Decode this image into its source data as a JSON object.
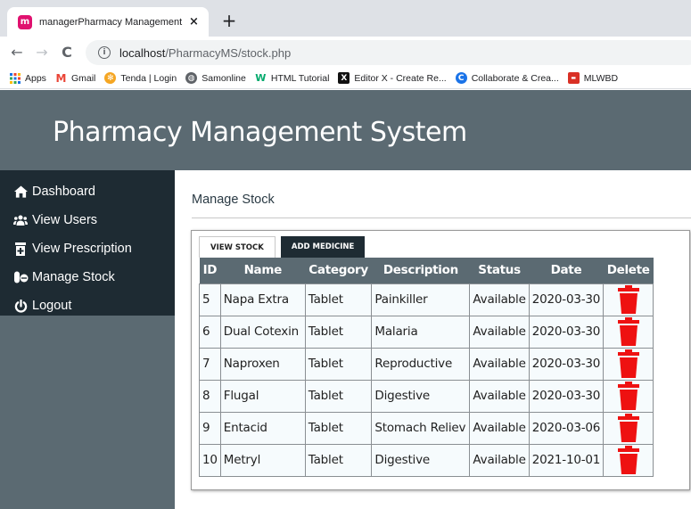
{
  "browser": {
    "tab_title": "managerPharmacy Management",
    "tab_close": "×",
    "new_tab": "+",
    "url_host": "localhost",
    "url_path": "/PharmacyMS/stock.php",
    "nav": {
      "back": "←",
      "forward": "→",
      "reload": "C"
    },
    "bookmarks": [
      {
        "label": "Apps",
        "icon": "apps-icon"
      },
      {
        "label": "Gmail",
        "icon": "gmail-icon"
      },
      {
        "label": "Tenda | Login",
        "icon": "tenda-icon"
      },
      {
        "label": "Samonline",
        "icon": "globe-icon"
      },
      {
        "label": "HTML Tutorial",
        "icon": "w3-icon"
      },
      {
        "label": "Editor X - Create Re...",
        "icon": "editorx-icon"
      },
      {
        "label": "Collaborate & Crea...",
        "icon": "collab-icon"
      },
      {
        "label": "MLWBD",
        "icon": "mlwbd-icon"
      }
    ]
  },
  "header": {
    "title": "Pharmacy Management System"
  },
  "sidebar": {
    "items": [
      {
        "label": "Dashboard",
        "icon": "home-icon"
      },
      {
        "label": "View Users",
        "icon": "users-icon"
      },
      {
        "label": "View Prescription",
        "icon": "prescription-icon"
      },
      {
        "label": "Manage Stock",
        "icon": "pills-icon"
      },
      {
        "label": "Logout",
        "icon": "power-icon"
      }
    ]
  },
  "main": {
    "heading": "Manage Stock",
    "tabs": [
      {
        "label": "VIEW STOCK",
        "active": true
      },
      {
        "label": "ADD MEDICINE",
        "active": false
      }
    ],
    "table": {
      "columns": [
        "ID",
        "Name",
        "Category",
        "Description",
        "Status",
        "Date",
        "Delete"
      ],
      "rows": [
        {
          "id": "5",
          "name": "Napa Extra",
          "category": "Tablet",
          "description": "Painkiller",
          "status": "Available",
          "date": "2020-03-30"
        },
        {
          "id": "6",
          "name": "Dual Cotexin",
          "category": "Tablet",
          "description": "Malaria",
          "status": "Available",
          "date": "2020-03-30"
        },
        {
          "id": "7",
          "name": "Naproxen",
          "category": "Tablet",
          "description": "Reproductive",
          "status": "Available",
          "date": "2020-03-30"
        },
        {
          "id": "8",
          "name": "Flugal",
          "category": "Tablet",
          "description": "Digestive",
          "status": "Available",
          "date": "2020-03-30"
        },
        {
          "id": "9",
          "name": "Entacid",
          "category": "Tablet",
          "description": "Stomach Reliev",
          "status": "Available",
          "date": "2020-03-06"
        },
        {
          "id": "10",
          "name": "Metryl",
          "category": "Tablet",
          "description": "Digestive",
          "status": "Available",
          "date": "2021-10-01"
        }
      ]
    }
  },
  "colors": {
    "header_bg": "#5b6a72",
    "sidebar_menu_bg": "#1e2b33",
    "delete_icon": "#ee1111"
  }
}
